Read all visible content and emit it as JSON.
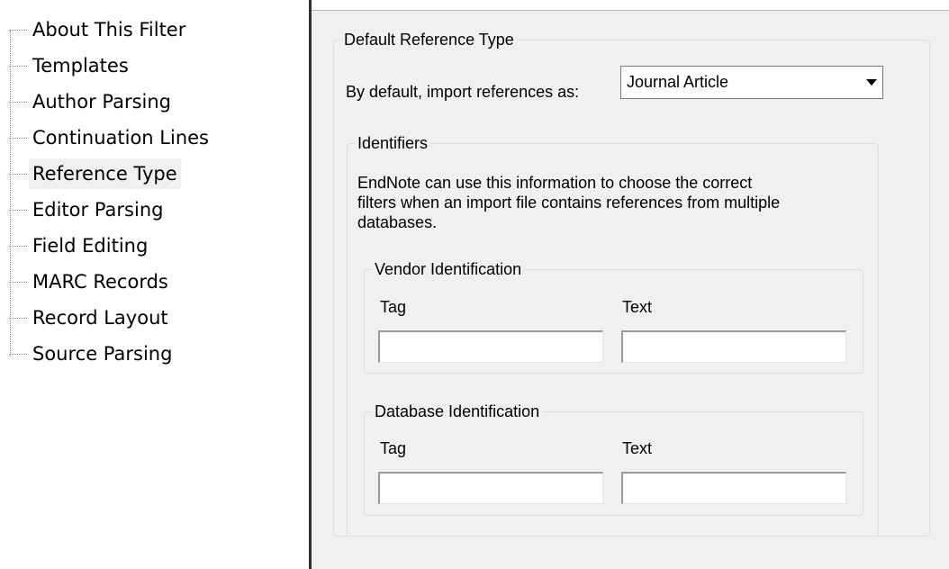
{
  "tree": {
    "items": [
      {
        "label": "About This Filter"
      },
      {
        "label": "Templates"
      },
      {
        "label": "Author Parsing"
      },
      {
        "label": "Continuation Lines"
      },
      {
        "label": "Reference Type"
      },
      {
        "label": "Editor Parsing"
      },
      {
        "label": "Field Editing"
      },
      {
        "label": "MARC Records"
      },
      {
        "label": "Record Layout"
      },
      {
        "label": "Source Parsing"
      }
    ],
    "selected_index": 4
  },
  "default_ref": {
    "legend": "Default Reference Type",
    "import_label": "By default, import references as:",
    "import_value": "Journal Article"
  },
  "identifiers": {
    "legend": "Identifiers",
    "description_line1": "EndNote can use this information to choose the correct",
    "description_line2": "filters when an import file contains references from multiple",
    "description_line3": "databases."
  },
  "vendor": {
    "legend": "Vendor Identification",
    "tag_label": "Tag",
    "text_label": "Text",
    "tag_value": "",
    "text_value": ""
  },
  "database": {
    "legend": "Database Identification",
    "tag_label": "Tag",
    "text_label": "Text",
    "tag_value": "",
    "text_value": ""
  }
}
